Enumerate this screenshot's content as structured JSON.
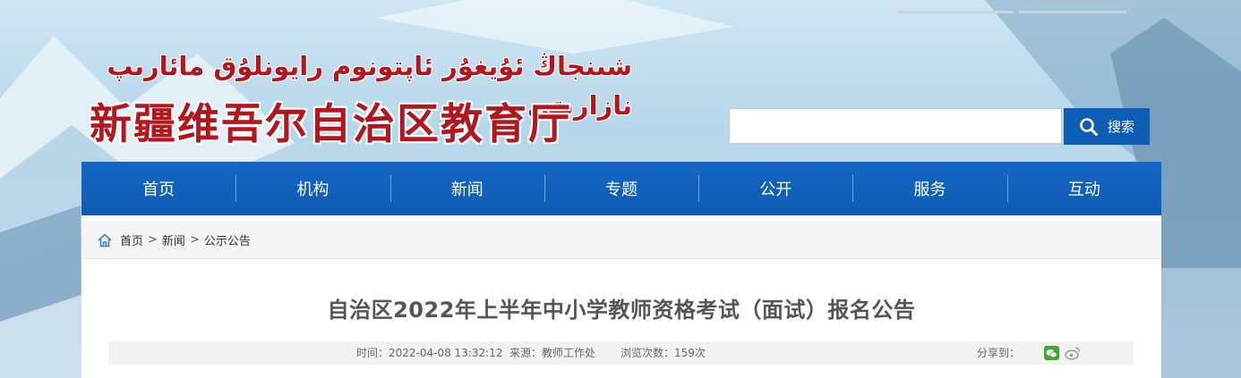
{
  "header": {
    "title_uyghur": "شىنجاڭ ئۇيغۇر ئاپتونوم رايونلۇق مائارىپ نازارىتى",
    "title_chinese": "新疆维吾尔自治区教育厅"
  },
  "search": {
    "placeholder": "",
    "button_label": "搜索"
  },
  "nav": {
    "items": [
      "首页",
      "机构",
      "新闻",
      "专题",
      "公开",
      "服务",
      "互动"
    ]
  },
  "breadcrumb": {
    "items": [
      "首页",
      "新闻",
      "公示公告"
    ],
    "separator": ">"
  },
  "article": {
    "title": "自治区2022年上半年中小学教师资格考试（面试）报名公告",
    "time": "时间：2022-04-08 13:32:12",
    "source": "来源：教师工作处",
    "views": "浏览次数：159次",
    "share_label": "分享到："
  },
  "colors": {
    "brand_red": "#b3161d",
    "nav_blue": "#0f5bb3",
    "wechat_green": "#3bab2b"
  },
  "icons": [
    "search-icon",
    "home-icon",
    "wechat-icon",
    "weibo-icon"
  ]
}
